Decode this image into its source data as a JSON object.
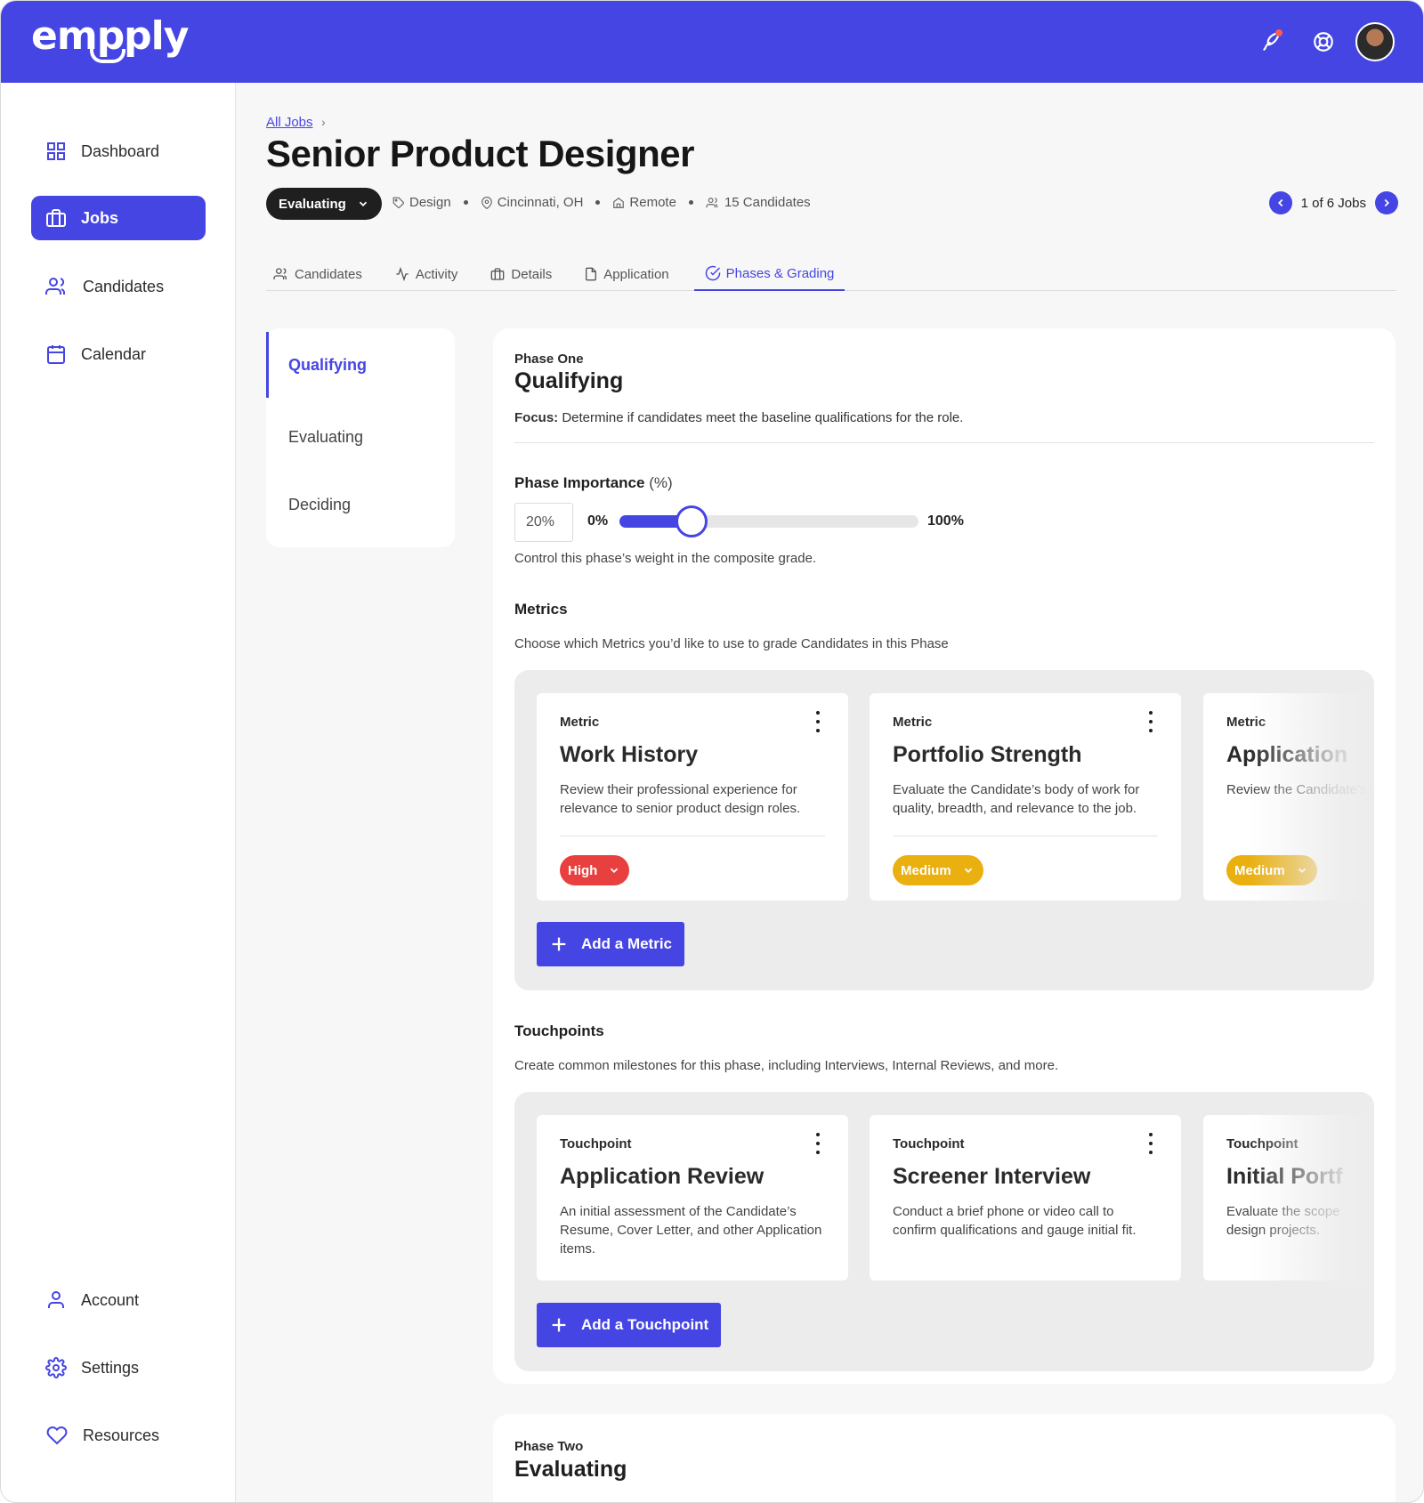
{
  "header": {
    "logo": "empply",
    "icons": [
      "rocket-icon",
      "help-icon"
    ],
    "colors": {
      "brand": "#4545e4",
      "notification": "#ff5a4e"
    }
  },
  "sidebar": {
    "items": [
      {
        "label": "Dashboard",
        "icon": "grid-icon"
      },
      {
        "label": "Jobs",
        "icon": "briefcase-icon",
        "active": true
      },
      {
        "label": "Candidates",
        "icon": "users-icon"
      },
      {
        "label": "Calendar",
        "icon": "calendar-icon"
      }
    ],
    "bottom_items": [
      {
        "label": "Account",
        "icon": "user-icon"
      },
      {
        "label": "Settings",
        "icon": "gear-icon"
      },
      {
        "label": "Resources",
        "icon": "heart-icon"
      }
    ]
  },
  "job": {
    "breadcrumb": "All Jobs",
    "title": "Senior Product Designer",
    "status": "Evaluating",
    "meta": {
      "department": "Design",
      "location": "Cincinnati, OH",
      "workplace": "Remote",
      "candidates": "15 Candidates"
    },
    "pager": "1 of 6 Jobs"
  },
  "tabs": [
    {
      "label": "Candidates",
      "icon": "users-icon"
    },
    {
      "label": "Activity",
      "icon": "activity-icon"
    },
    {
      "label": "Details",
      "icon": "briefcase-icon"
    },
    {
      "label": "Application",
      "icon": "document-icon"
    },
    {
      "label": "Phases & Grading",
      "icon": "check-circle-icon",
      "active": true
    }
  ],
  "phase_list": [
    "Qualifying",
    "Evaluating",
    "Deciding"
  ],
  "phase_one": {
    "eyebrow": "Phase One",
    "name": "Qualifying",
    "focus_label": "Focus:",
    "focus_text": "Determine if candidates meet the baseline qualifications for the role.",
    "importance": {
      "title": "Phase Importance",
      "unit": "(%)",
      "value": "20%",
      "value_fraction": 0.2,
      "min_label": "0%",
      "max_label": "100%",
      "help": "Control this phase’s weight in the composite grade."
    },
    "metrics": {
      "title": "Metrics",
      "desc": "Choose which Metrics you’d like to use to grade Candidates in this Phase",
      "cards": [
        {
          "label": "Metric",
          "title": "Work History",
          "desc": "Review their professional experience for relevance to senior product design roles.",
          "importance": "High",
          "color": "#e8403f"
        },
        {
          "label": "Metric",
          "title": "Portfolio Strength",
          "desc": "Evaluate the Candidate’s body of work for quality, breadth, and relevance to the job.",
          "importance": "Medium",
          "color": "#e9b010"
        },
        {
          "label": "Metric",
          "title": "Application",
          "desc": "Review the Candidate’s questions on the Ap",
          "importance": "Medium",
          "color": "#e9b010"
        }
      ],
      "add_label": "Add a Metric"
    },
    "touchpoints": {
      "title": "Touchpoints",
      "desc": "Create common milestones for this phase, including Interviews, Internal Reviews, and more.",
      "cards": [
        {
          "label": "Touchpoint",
          "title": "Application Review",
          "desc": "An initial assessment of the Candidate’s Resume, Cover Letter, and other Application items."
        },
        {
          "label": "Touchpoint",
          "title": "Screener Interview",
          "desc": "Conduct a brief phone or video call to confirm qualifications and gauge initial fit."
        },
        {
          "label": "Touchpoint",
          "title": "Initial Portf",
          "desc": "Evaluate the scope design projects."
        }
      ],
      "add_label": "Add a Touchpoint"
    }
  },
  "phase_two": {
    "eyebrow": "Phase Two",
    "name": "Evaluating"
  }
}
